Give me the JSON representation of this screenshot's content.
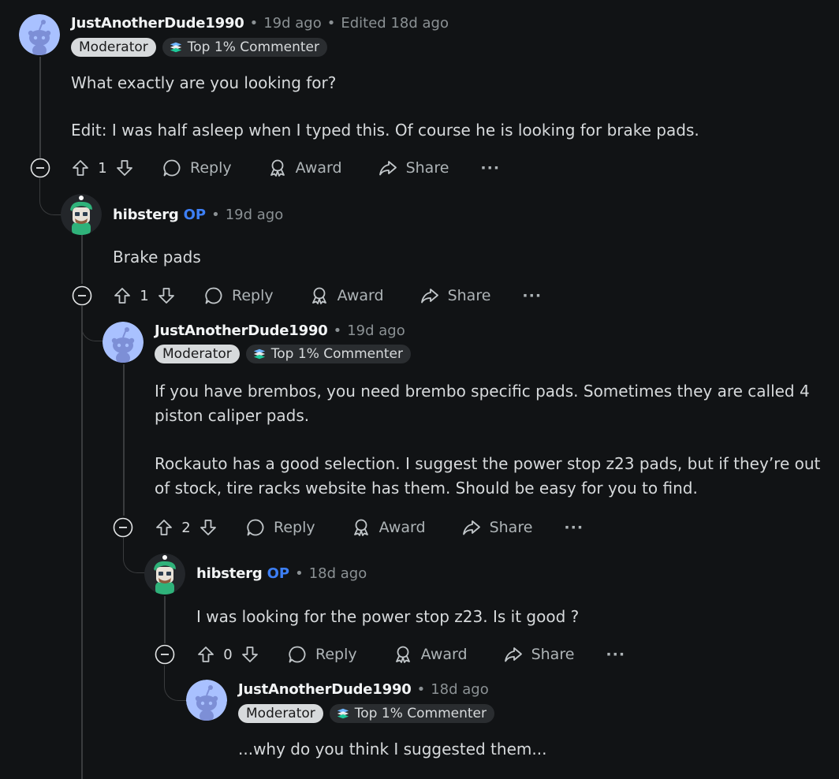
{
  "comments": [
    {
      "author": "JustAnotherDude1990",
      "op_label": "",
      "time": "19d ago",
      "edited": "Edited 18d ago",
      "badges": {
        "moderator": "Moderator",
        "top": "Top 1% Commenter"
      },
      "paragraphs": [
        "What exactly are you looking for?",
        "Edit: I was half asleep when I typed this. Of course he is looking for brake pads."
      ],
      "score": "1"
    },
    {
      "author": "hibsterg",
      "op_label": "OP",
      "time": "19d ago",
      "paragraphs": [
        "Brake pads"
      ],
      "score": "1"
    },
    {
      "author": "JustAnotherDude1990",
      "time": "19d ago",
      "badges": {
        "moderator": "Moderator",
        "top": "Top 1% Commenter"
      },
      "paragraphs": [
        "If you have brembos, you need brembo specific pads. Sometimes they are called 4 piston caliper pads.",
        "Rockauto has a good selection. I suggest the power stop z23 pads, but if they’re out of stock, tire racks website has them. Should be easy for you to find."
      ],
      "score": "2"
    },
    {
      "author": "hibsterg",
      "op_label": "OP",
      "time": "18d ago",
      "paragraphs": [
        "I was looking for the power stop z23. Is it good ?"
      ],
      "score": "0"
    },
    {
      "author": "JustAnotherDude1990",
      "time": "18d ago",
      "badges": {
        "moderator": "Moderator",
        "top": "Top 1% Commenter"
      },
      "paragraphs": [
        "...why do you think I suggested them..."
      ]
    }
  ],
  "actions": {
    "reply": "Reply",
    "award": "Award",
    "share": "Share",
    "more": "···"
  },
  "separator": "•",
  "icons": [
    "snoo-avatar-icon",
    "character-avatar-icon",
    "collapse-icon",
    "upvote-icon",
    "downvote-icon",
    "comment-icon",
    "award-icon",
    "share-icon",
    "more-icon",
    "top-commenter-icon"
  ],
  "colors": {
    "background": "#111315",
    "op": "#3d7ff5",
    "muted": "#8b9194",
    "moderator_badge": "#d7dadc"
  }
}
